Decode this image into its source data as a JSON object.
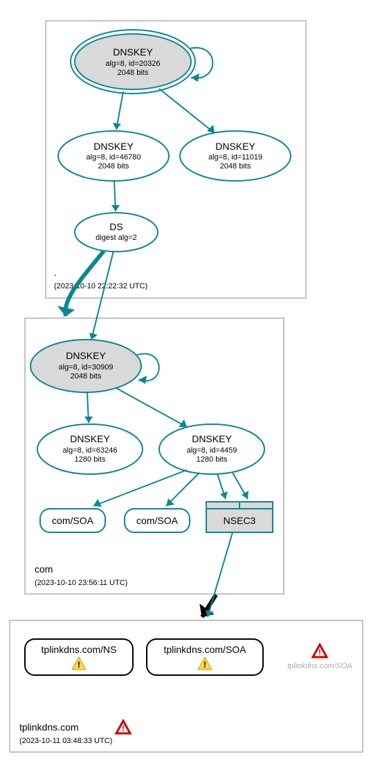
{
  "zones": {
    "root": {
      "label": ".",
      "timestamp": "(2023-10-10 22:22:32 UTC)",
      "nodes": {
        "key_root": {
          "title": "DNSKEY",
          "sub1": "alg=8, id=20326",
          "sub2": "2048 bits"
        },
        "key_46780": {
          "title": "DNSKEY",
          "sub1": "alg=8, id=46780",
          "sub2": "2048 bits"
        },
        "key_11019": {
          "title": "DNSKEY",
          "sub1": "alg=8, id=11019",
          "sub2": "2048 bits"
        },
        "ds": {
          "title": "DS",
          "sub1": "digest alg=2"
        }
      }
    },
    "com": {
      "label": "com",
      "timestamp": "(2023-10-10 23:56:11 UTC)",
      "nodes": {
        "key_30909": {
          "title": "DNSKEY",
          "sub1": "alg=8, id=30909",
          "sub2": "2048 bits"
        },
        "key_63246": {
          "title": "DNSKEY",
          "sub1": "alg=8, id=63246",
          "sub2": "1280 bits"
        },
        "key_4459": {
          "title": "DNSKEY",
          "sub1": "alg=8, id=4459",
          "sub2": "1280 bits"
        },
        "soa1": {
          "title": "com/SOA"
        },
        "soa2": {
          "title": "com/SOA"
        },
        "nsec3": {
          "title": "NSEC3"
        }
      }
    },
    "tplinkdns": {
      "label": "tplinkdns.com",
      "timestamp": "(2023-10-11 03:48:33 UTC)",
      "nodes": {
        "ns": {
          "title": "tplinkdns.com/NS"
        },
        "soa": {
          "title": "tplinkdns.com/SOA"
        },
        "soa_gray": {
          "title": "tplinkdns.com/SOA"
        }
      }
    }
  },
  "chart_data": {
    "type": "dnssec-delegation-graph",
    "zones": [
      {
        "name": ".",
        "timestamp": "2023-10-10 22:22:32 UTC",
        "records": [
          {
            "type": "DNSKEY",
            "alg": 8,
            "id": 20326,
            "bits": 2048,
            "ksk": true,
            "self_signed": true
          },
          {
            "type": "DNSKEY",
            "alg": 8,
            "id": 46780,
            "bits": 2048
          },
          {
            "type": "DNSKEY",
            "alg": 8,
            "id": 11019,
            "bits": 2048
          },
          {
            "type": "DS",
            "digest_alg": 2
          }
        ],
        "edges": [
          {
            "from": "DNSKEY/20326",
            "to": "DNSKEY/20326"
          },
          {
            "from": "DNSKEY/20326",
            "to": "DNSKEY/46780"
          },
          {
            "from": "DNSKEY/20326",
            "to": "DNSKEY/11019"
          },
          {
            "from": "DNSKEY/46780",
            "to": "DS"
          }
        ]
      },
      {
        "name": "com",
        "timestamp": "2023-10-10 23:56:11 UTC",
        "records": [
          {
            "type": "DNSKEY",
            "alg": 8,
            "id": 30909,
            "bits": 2048,
            "ksk": true,
            "self_signed": true
          },
          {
            "type": "DNSKEY",
            "alg": 8,
            "id": 63246,
            "bits": 1280
          },
          {
            "type": "DNSKEY",
            "alg": 8,
            "id": 4459,
            "bits": 1280
          },
          {
            "type": "SOA",
            "name": "com"
          },
          {
            "type": "SOA",
            "name": "com"
          },
          {
            "type": "NSEC3"
          }
        ],
        "edges": [
          {
            "from": "./DS",
            "to": "DNSKEY/30909",
            "delegation": true
          },
          {
            "from": "DNSKEY/30909",
            "to": "DNSKEY/30909"
          },
          {
            "from": "DNSKEY/30909",
            "to": "DNSKEY/63246"
          },
          {
            "from": "DNSKEY/30909",
            "to": "DNSKEY/4459"
          },
          {
            "from": "DNSKEY/4459",
            "to": "com/SOA"
          },
          {
            "from": "DNSKEY/4459",
            "to": "com/SOA"
          },
          {
            "from": "DNSKEY/4459",
            "to": "NSEC3"
          },
          {
            "from": "DNSKEY/4459",
            "to": "NSEC3"
          }
        ]
      },
      {
        "name": "tplinkdns.com",
        "timestamp": "2023-10-11 03:48:33 UTC",
        "status": "error",
        "records": [
          {
            "type": "NS",
            "name": "tplinkdns.com",
            "status": "warning"
          },
          {
            "type": "SOA",
            "name": "tplinkdns.com",
            "status": "warning"
          },
          {
            "type": "SOA",
            "name": "tplinkdns.com",
            "status": "error",
            "unavailable": true
          }
        ],
        "edges": [
          {
            "from": "com/NSEC3",
            "to": "tplinkdns.com",
            "delegation": true,
            "insecure": true
          }
        ]
      }
    ]
  }
}
